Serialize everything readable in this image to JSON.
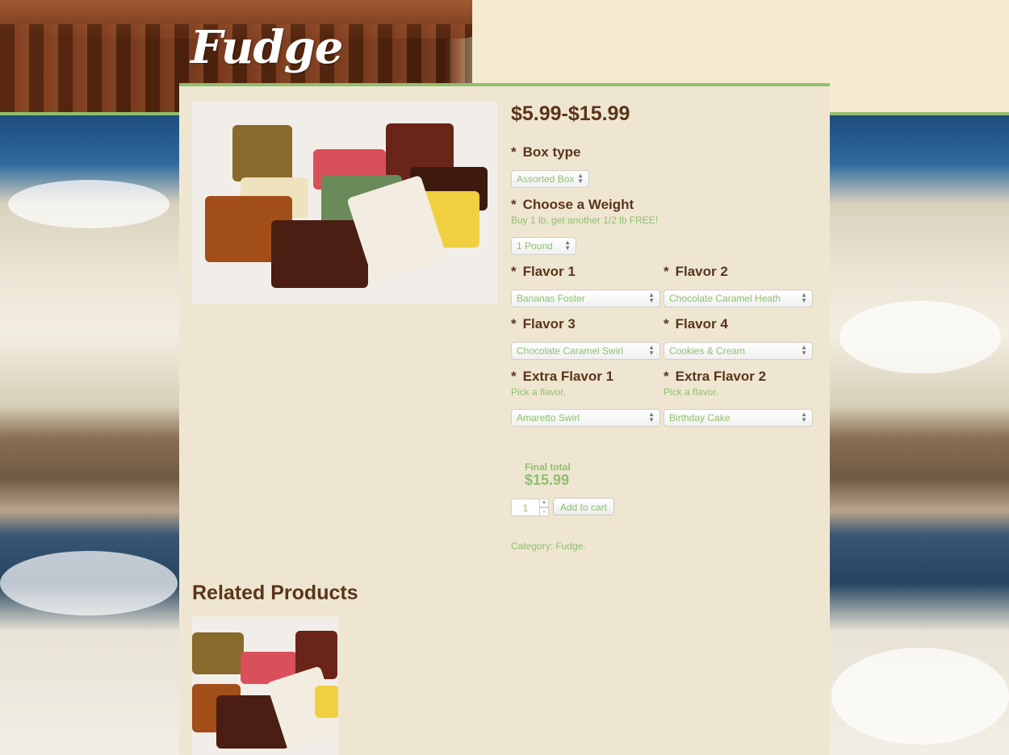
{
  "site": {
    "title": "Fudge"
  },
  "product": {
    "image_alt": "Assorted fudge pieces",
    "price": "$5.99-$15.99",
    "star": "*",
    "box_type": {
      "label": "Box type",
      "selected": "Assorted Box"
    },
    "weight": {
      "label": "Choose a Weight",
      "hint": "Buy 1 lb, get another 1/2 lb FREE!",
      "selected": "1 Pound"
    },
    "flavor1": {
      "label": "Flavor 1",
      "selected": "Bananas Foster"
    },
    "flavor2": {
      "label": "Flavor 2",
      "selected": "Chocolate Caramel Heath"
    },
    "flavor3": {
      "label": "Flavor 3",
      "selected": "Chocolate Caramel Swirl"
    },
    "flavor4": {
      "label": "Flavor 4",
      "selected": "Cookies & Cream"
    },
    "extra1": {
      "label": "Extra Flavor 1",
      "hint": "Pick a flavor.",
      "selected": "Amaretto Swirl"
    },
    "extra2": {
      "label": "Extra Flavor 2",
      "hint": "Pick a flavor.",
      "selected": "Birthday Cake"
    },
    "final_total_label": "Final total",
    "final_total": "$15.99",
    "quantity": "1",
    "qty_plus": "+",
    "qty_minus": "-",
    "add_to_cart": "Add to cart",
    "category": "Category: Fudge."
  },
  "related": {
    "title": "Related Products"
  },
  "colors": {
    "accent": "#8fbf6e",
    "heading": "#5a3519",
    "panel": "#efe6d2"
  },
  "icons": {
    "select_arrows": "updown-arrows-icon"
  }
}
